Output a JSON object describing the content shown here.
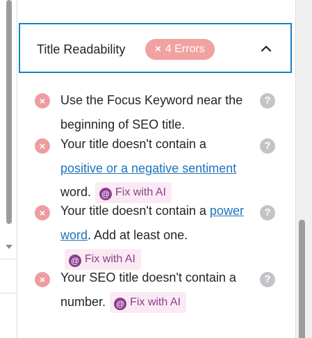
{
  "section": {
    "title": "Title Readability",
    "badge_icon": "×",
    "badge_label": "4 Errors"
  },
  "items": [
    {
      "text_parts": [
        "Use the Focus Keyword near the beginning of SEO title."
      ],
      "help": "?"
    },
    {
      "text_before": "Your title doesn't contain a ",
      "link": "positive or a negative sentiment",
      "text_after": " word.",
      "fix_label": "Fix with AI",
      "help": "?"
    },
    {
      "text_before": "Your title doesn't contain a ",
      "link": "power word",
      "text_after": ". Add at least one.",
      "fix_label": "Fix with AI",
      "help": "?"
    },
    {
      "text_before": "Your SEO title doesn't contain a number.",
      "fix_label": "Fix with AI",
      "help": "?"
    }
  ],
  "icons": {
    "error": "×",
    "help": "?",
    "ai": "@",
    "chevron": "chevron-up-icon"
  },
  "colors": {
    "header_border": "#1584c2",
    "error_badge": "#f2a1a1",
    "error_icon": "#ed9ea0",
    "link": "#1e73be",
    "fix_bg": "#fbeaf3",
    "fix_text": "#8a3f8f"
  }
}
